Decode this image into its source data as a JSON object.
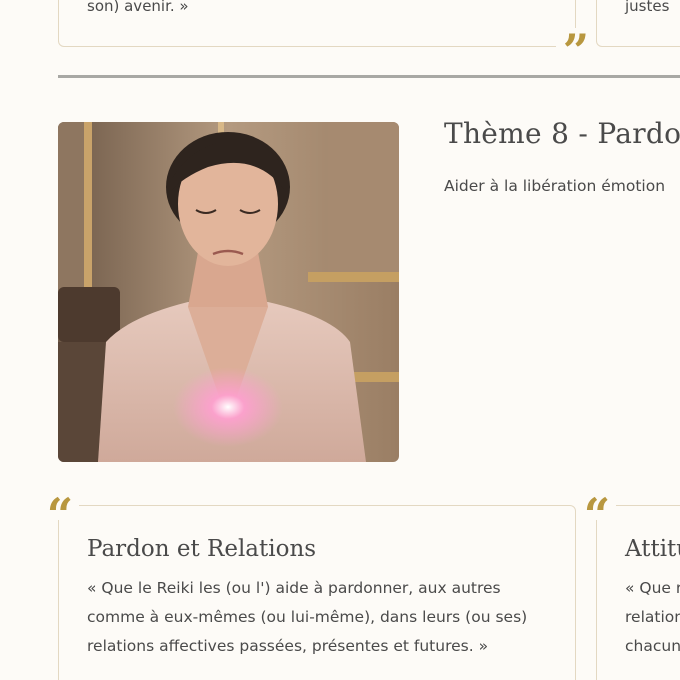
{
  "top_cards": {
    "left_tail": "son) avenir. »",
    "right_tail": "justes"
  },
  "theme": {
    "title": "Thème 8 - Pardo",
    "subtitle": "Aider à la libération émotion"
  },
  "cards": [
    {
      "title": "Pardon et Relations",
      "text": "« Que le Reiki les (ou l') aide à pardonner, aux autres comme à eux-mêmes (ou lui-même), dans leurs (ou ses) relations affectives passées, présentes et futures. »"
    },
    {
      "title": "Attitu",
      "lines": [
        "« Que r",
        "relation",
        "chacun"
      ]
    }
  ],
  "colors": {
    "background": "#fdfbf7",
    "accent_gold": "#b8973f",
    "card_border": "#e3d8c2",
    "divider": "#a8a8a4",
    "text": "#4a4a4a"
  },
  "icons": {
    "close_quote": "closing-quote-icon",
    "open_quote": "opening-quote-icon"
  }
}
